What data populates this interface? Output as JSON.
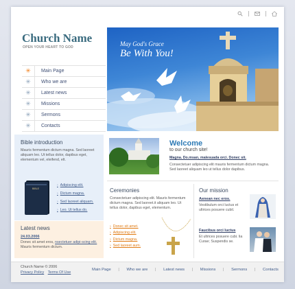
{
  "site": {
    "name": "Church Name",
    "tagline": "OPEN YOUR HEART TO GOD"
  },
  "nav": {
    "items": [
      {
        "label": "Main Page",
        "active": true
      },
      {
        "label": "Who we are",
        "active": false
      },
      {
        "label": "Latest news",
        "active": false
      },
      {
        "label": "Missions",
        "active": false
      },
      {
        "label": "Sermons",
        "active": false
      },
      {
        "label": "Contacts",
        "active": false
      }
    ]
  },
  "hero": {
    "line1": "May God's Grace",
    "line2": "Be With You!"
  },
  "bible": {
    "title": "Bible introduction",
    "text": "Mauris fermentum dictum magna. Sed laoreet aliquam leo. Ut tellus dolor, dapibus eget, elementum vel, eleifend, elt.",
    "book_label": "BIBLE",
    "links": [
      "Adipiscing elit.",
      "Dictum magna.",
      "Sed laoreet aliquam.",
      "Leo. Ut tellus do."
    ]
  },
  "news": {
    "title": "Latest news",
    "date": "24.03.2006",
    "text_before": "Donec sit amet eros, ",
    "text_link": "nsectetuer adipi-scing elit.",
    "text_after": " Mauris fermentum dictum."
  },
  "welcome": {
    "title": "Welcome",
    "subtitle": "to our church site!",
    "bold": "Magna. Do.msan, malesuada orci. Donec sit.",
    "text": "Consectetuer adipiscing elit mauris fermentum dictum magna. Sed laoreet aliquam leo ut tellus dolor dapibus."
  },
  "ceremonies": {
    "title": "Ceremonies",
    "text": "Consectetuer adipiscing elit. Mauris fermentum dictum magna. Sed laoreet.it aliquam leo. Ut tellus dolor, dapibus eget, elementum.",
    "links": [
      "Donec sit amet.",
      "Adipiscing elit.",
      "Dictum magna.",
      "Sed laoreet aum."
    ]
  },
  "mission": {
    "title": "Our mission",
    "items": [
      {
        "name": "Aenean nec eros.",
        "text": "Vestibulum orci luctus et ultrices posuere cubil."
      },
      {
        "name": "Faucibus orci luctus",
        "text": "Et ultrices posuere cubi. lia Curae; Suspendis se."
      }
    ]
  },
  "footer": {
    "copyright": "Church Name © 2006",
    "privacy": "Privacy Policy",
    "terms": "Terms Of Use",
    "nav": [
      "Main Page",
      "Who we are",
      "Latest news",
      "Missions",
      "Sermons",
      "Contacts"
    ]
  },
  "colors": {
    "brand": "#3a6b7f",
    "accent": "#f07b13",
    "link": "#3f5b8a",
    "welcome": "#2d7ab5",
    "sky": "#2f76cf"
  },
  "icons": {
    "nav_bullet": "star-burst-icon",
    "top_left": "search-icon",
    "top_mid": "mail-icon",
    "top_right": "home-icon"
  }
}
